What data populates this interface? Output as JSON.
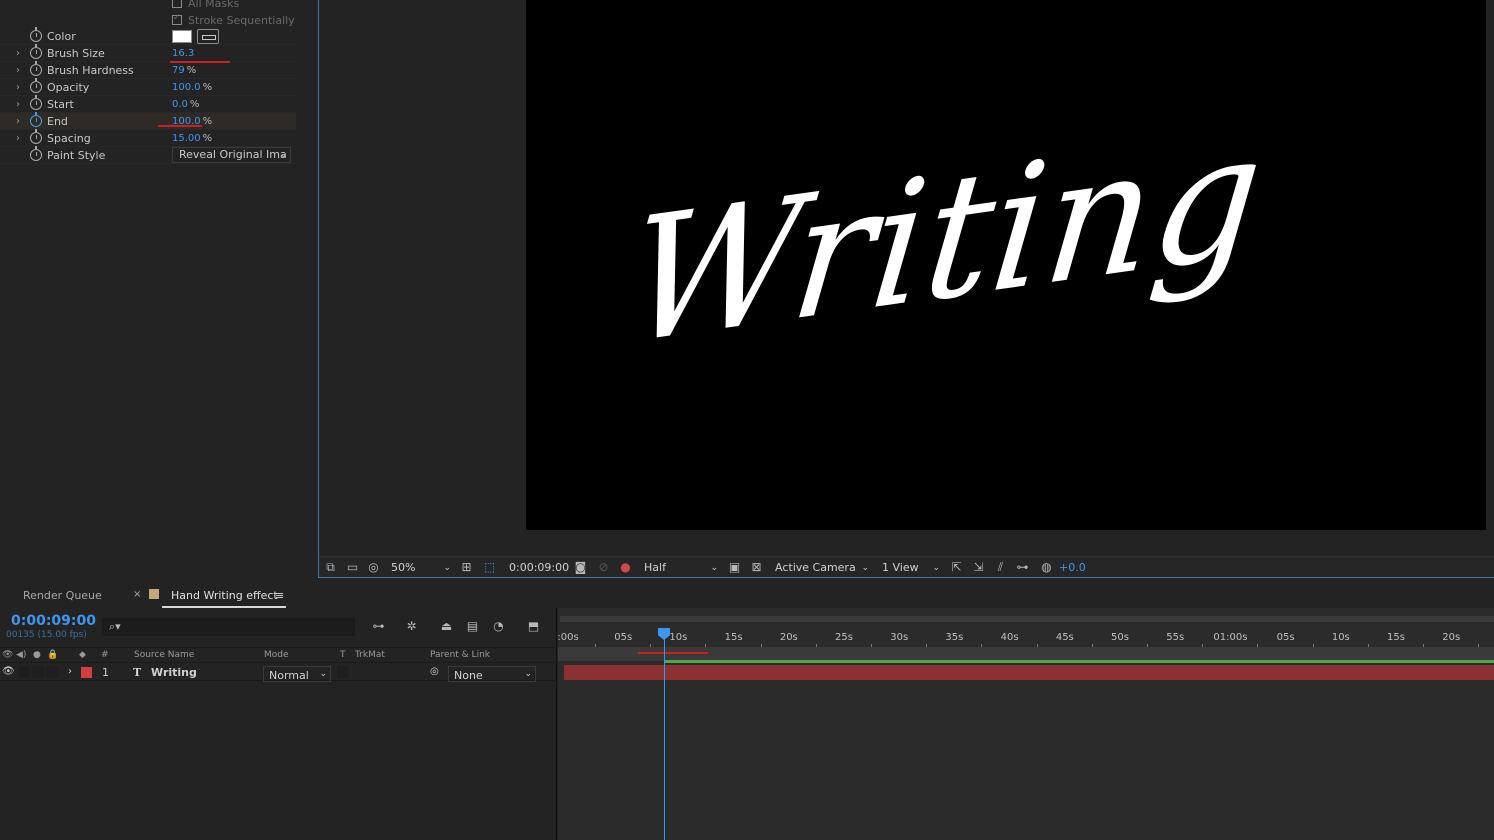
{
  "effect_controls": {
    "top_checkboxes": [
      {
        "label": "All Masks",
        "checked": false
      },
      {
        "label": "Stroke Sequentially",
        "checked": true
      }
    ],
    "properties": [
      {
        "label": "Color",
        "value": "",
        "unit": ""
      },
      {
        "label": "Brush Size",
        "value": "16.3",
        "unit": ""
      },
      {
        "label": "Brush Hardness",
        "value": "79",
        "unit": "%"
      },
      {
        "label": "Opacity",
        "value": "100.0",
        "unit": "%"
      },
      {
        "label": "Start",
        "value": "0.0",
        "unit": "%"
      },
      {
        "label": "End",
        "value": "100.0",
        "unit": "%"
      },
      {
        "label": "Spacing",
        "value": "15.00",
        "unit": "%"
      },
      {
        "label": "Paint Style",
        "value": "Reveal Original Ima",
        "unit": ""
      }
    ],
    "color_swatch": "#ffffff"
  },
  "viewer": {
    "canvas_text": "Writing",
    "toolbar": {
      "zoom": "50%",
      "timecode": "0:00:09:00",
      "resolution": "Half",
      "camera": "Active Camera",
      "views": "1 View",
      "exposure": "+0.0"
    }
  },
  "timeline": {
    "tabs": {
      "render_queue": "Render Queue",
      "close": "×",
      "comp_name": "Hand Writing effect",
      "menu": "≡"
    },
    "comp_color": "#c5a77a",
    "timecode": "0:00:09:00",
    "frame_info": "00135 (15.00 fps)",
    "search_placeholder": "⌕▾",
    "columns": {
      "num": "#",
      "source_name": "Source Name",
      "mode": "Mode",
      "t": "T",
      "trkmat": "TrkMat",
      "parent": "Parent & Link"
    },
    "layers": [
      {
        "num": "1",
        "type_icon": "T",
        "name": "Writing",
        "mode": "Normal",
        "parent": "None",
        "label_color": "#d23d3d"
      }
    ],
    "ruler_ticks": [
      ":00s",
      "05s",
      "10s",
      "15s",
      "20s",
      "25s",
      "30s",
      "35s",
      "40s",
      "45s",
      "50s",
      "55s",
      "01:00s",
      "05s",
      "10s",
      "15s",
      "20s"
    ],
    "playhead_seconds": 9
  }
}
